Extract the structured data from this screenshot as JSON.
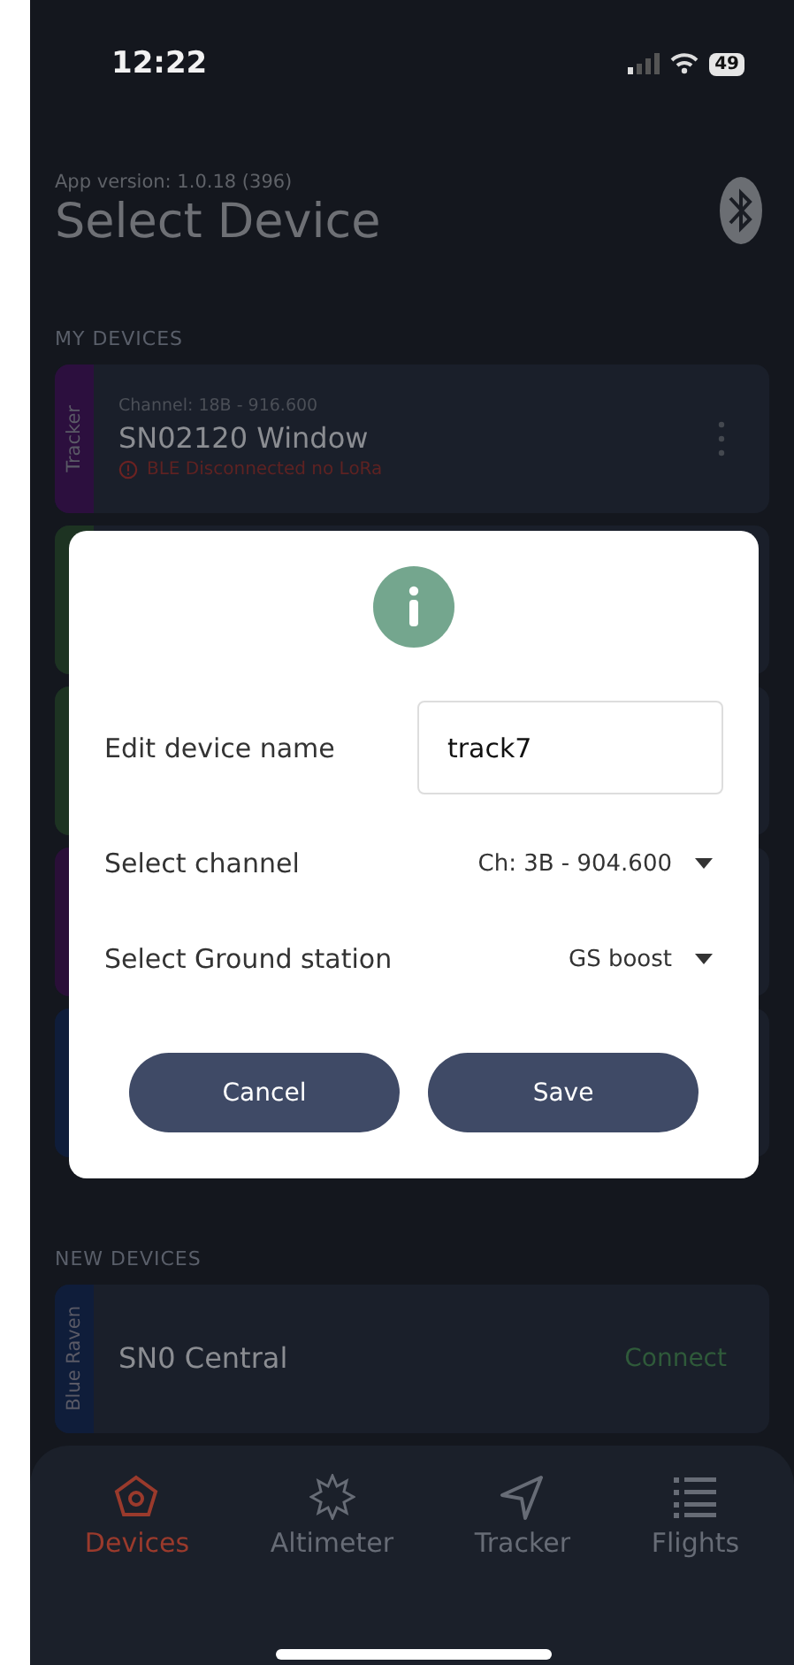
{
  "status_bar": {
    "time": "12:22",
    "battery": "49"
  },
  "header": {
    "app_version": "App version: 1.0.18 (396)",
    "title": "Select Device"
  },
  "my_devices": {
    "heading": "MY DEVICES",
    "devices": [
      {
        "type": "Tracker",
        "color": "#2c0f3e",
        "channel": "Channel: 18B - 916.600",
        "name": "SN02120 Window",
        "status": "BLE Disconnected no LoRa"
      }
    ],
    "covered_cards": [
      {
        "color": "#1d3322"
      },
      {
        "color": "#1d3322"
      },
      {
        "color": "#2a0f38"
      },
      {
        "color": "#0f1d3a"
      }
    ]
  },
  "new_devices": {
    "heading": "NEW DEVICES",
    "devices": [
      {
        "type": "Blue Raven",
        "color": "#0f1d3a",
        "name": "SN0 Central",
        "action": "Connect"
      }
    ]
  },
  "dialog": {
    "name_label": "Edit device name",
    "name_value": "track7",
    "channel_label": "Select channel",
    "channel_value": "Ch: 3B - 904.600",
    "station_label": "Select Ground station",
    "station_value": "GS boost",
    "buttons": [
      "Cancel",
      "Save"
    ]
  },
  "tabs": [
    {
      "label": "Devices",
      "kind": "pentagon",
      "selected": true
    },
    {
      "label": "Altimeter",
      "kind": "burst",
      "selected": false
    },
    {
      "label": "Tracker",
      "kind": "navigate",
      "selected": false
    },
    {
      "label": "Flights",
      "kind": "list",
      "selected": false
    }
  ]
}
